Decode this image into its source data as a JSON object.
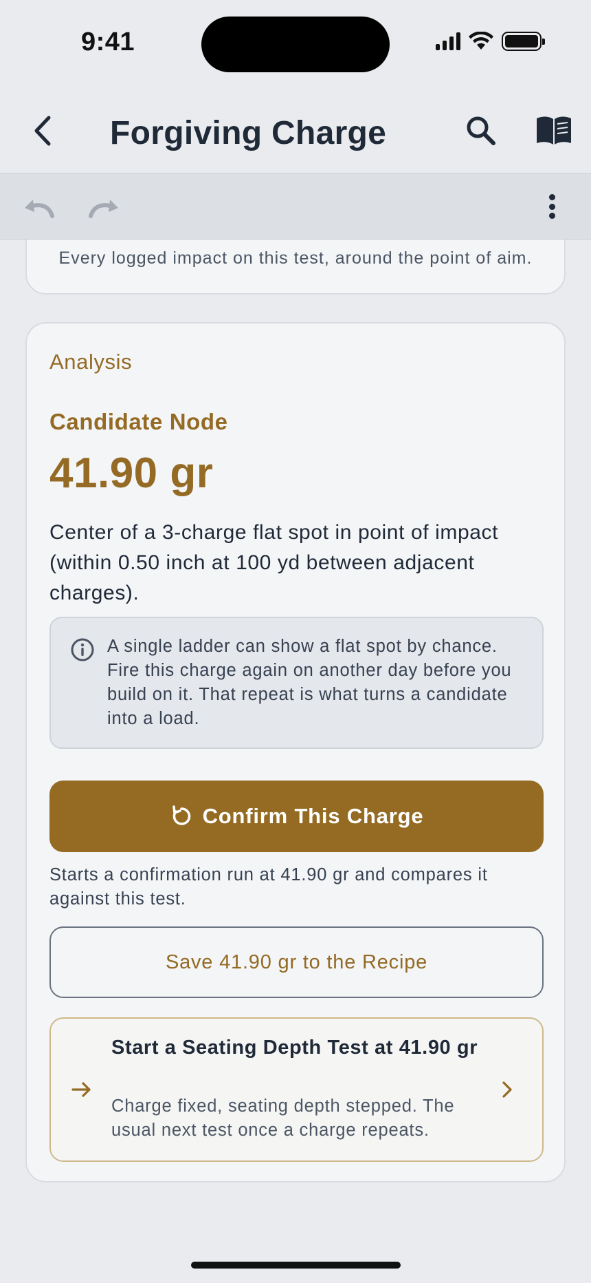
{
  "status_bar": {
    "time": "9:41"
  },
  "nav": {
    "title": "Forgiving Charge",
    "icons": {
      "back": "chevron-left-icon",
      "search": "search-icon",
      "reference": "open-book-icon"
    }
  },
  "toolbar": {
    "icons": {
      "undo": "undo-icon",
      "redo": "redo-icon",
      "more": "more-vertical-icon"
    }
  },
  "previous_card": {
    "caption": "Every logged impact on this test, around the point of aim."
  },
  "analysis": {
    "section_label": "Analysis",
    "node_label": "Candidate Node",
    "node_value": "41.90 gr",
    "node_description": "Center of a 3-charge flat spot in point of impact (within 0.50 inch at 100 yd between adjacent charges).",
    "info_icon": "info-circle-icon",
    "info_text": "A single ladder can show a flat spot by chance. Fire this charge again on another day before you build on it. That repeat is what turns a candidate into a load.",
    "confirm_button": {
      "label": "Confirm This Charge",
      "icon": "refresh-icon"
    },
    "confirm_note": "Starts a confirmation run at 41.90 gr and compares it against this test.",
    "save_button": {
      "label": "Save 41.90 gr to the Recipe"
    },
    "seating_test": {
      "title": "Start a Seating Depth Test at 41.90 gr",
      "subtitle": "Charge fixed, seating depth stepped. The usual next test once a charge repeats.",
      "icon": "arrow-right-icon",
      "chevron": "chevron-right-icon"
    }
  },
  "colors": {
    "accent": "#956b24",
    "accent_text": "#946a24",
    "background": "#e9ebee",
    "card": "#f3f5f7",
    "text": "#1f2937"
  }
}
